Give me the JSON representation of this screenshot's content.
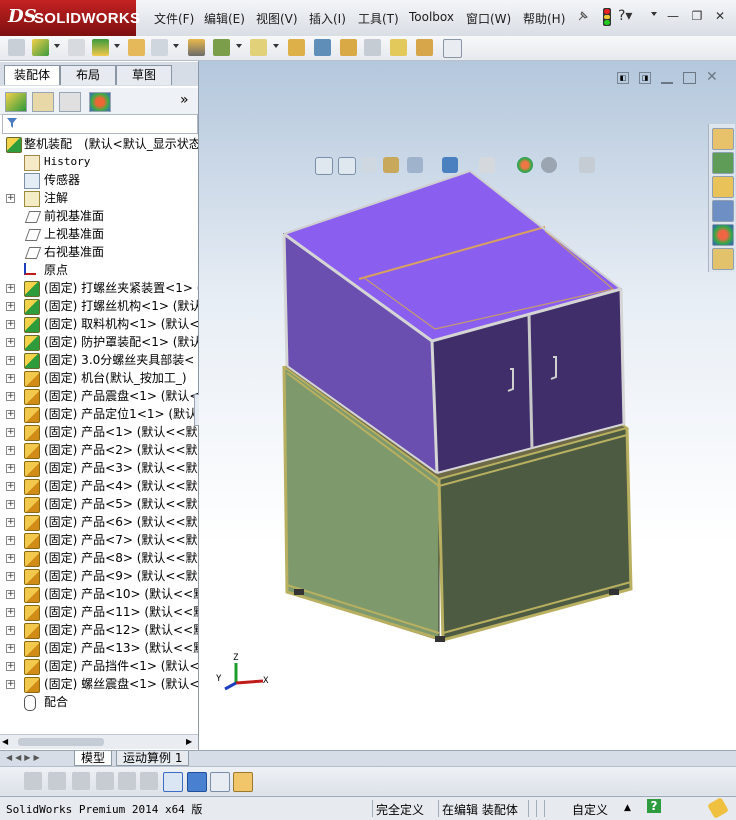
{
  "app": {
    "logo_ds": "DS",
    "logo_text": "SOLIDWORKS",
    "menus": [
      "文件(F)",
      "编辑(E)",
      "视图(V)",
      "插入(I)",
      "工具(T)",
      "Toolbox",
      "窗口(W)",
      "帮助(H)"
    ],
    "window_controls": [
      "—",
      "❐",
      "✕"
    ]
  },
  "manager": {
    "tabs": [
      "装配体",
      "布局",
      "草图"
    ],
    "more": "»",
    "tree": [
      {
        "label": "整机装配　(默认<默认_显示状态",
        "icon": "assembly-icon",
        "expand": "",
        "indent": 0,
        "mono": false
      },
      {
        "label": "History",
        "icon": "history-icon",
        "expand": "",
        "indent": 1,
        "mono": true
      },
      {
        "label": "传感器",
        "icon": "sensor-icon",
        "expand": "",
        "indent": 1,
        "mono": false
      },
      {
        "label": "注解",
        "icon": "annotation-icon",
        "expand": "+",
        "indent": 1,
        "mono": false
      },
      {
        "label": "前视基准面",
        "icon": "plane-icon",
        "expand": "",
        "indent": 1,
        "mono": false
      },
      {
        "label": "上视基准面",
        "icon": "plane-icon",
        "expand": "",
        "indent": 1,
        "mono": false
      },
      {
        "label": "右视基准面",
        "icon": "plane-icon",
        "expand": "",
        "indent": 1,
        "mono": false
      },
      {
        "label": "原点",
        "icon": "origin-icon",
        "expand": "",
        "indent": 1,
        "mono": false
      },
      {
        "label": "(固定) 打螺丝夹紧装置<1> (",
        "icon": "subassembly-icon",
        "expand": "+",
        "indent": 1,
        "mono": false
      },
      {
        "label": "(固定) 打螺丝机构<1> (默认",
        "icon": "subassembly-icon",
        "expand": "+",
        "indent": 1,
        "mono": false
      },
      {
        "label": "(固定) 取料机构<1> (默认<",
        "icon": "subassembly-icon",
        "expand": "+",
        "indent": 1,
        "mono": false
      },
      {
        "label": "(固定) 防护罩装配<1> (默认",
        "icon": "subassembly-icon",
        "expand": "+",
        "indent": 1,
        "mono": false
      },
      {
        "label": "(固定) 3.0分螺丝夹具部装<",
        "icon": "subassembly-icon",
        "expand": "+",
        "indent": 1,
        "mono": false
      },
      {
        "label": "(固定) 机台(默认_按加工_)",
        "icon": "part-icon",
        "expand": "+",
        "indent": 1,
        "mono": false
      },
      {
        "label": "(固定) 产品震盘<1> (默认<",
        "icon": "part-icon",
        "expand": "+",
        "indent": 1,
        "mono": false
      },
      {
        "label": "(固定) 产品定位1<1> (默认",
        "icon": "part-icon",
        "expand": "+",
        "indent": 1,
        "mono": false
      },
      {
        "label": "(固定) 产品<1> (默认<<默认",
        "icon": "part-icon",
        "expand": "+",
        "indent": 1,
        "mono": false
      },
      {
        "label": "(固定) 产品<2> (默认<<默认",
        "icon": "part-icon",
        "expand": "+",
        "indent": 1,
        "mono": false
      },
      {
        "label": "(固定) 产品<3> (默认<<默认",
        "icon": "part-icon",
        "expand": "+",
        "indent": 1,
        "mono": false
      },
      {
        "label": "(固定) 产品<4> (默认<<默认",
        "icon": "part-icon",
        "expand": "+",
        "indent": 1,
        "mono": false
      },
      {
        "label": "(固定) 产品<5> (默认<<默认",
        "icon": "part-icon",
        "expand": "+",
        "indent": 1,
        "mono": false
      },
      {
        "label": "(固定) 产品<6> (默认<<默认",
        "icon": "part-icon",
        "expand": "+",
        "indent": 1,
        "mono": false
      },
      {
        "label": "(固定) 产品<7> (默认<<默认",
        "icon": "part-icon",
        "expand": "+",
        "indent": 1,
        "mono": false
      },
      {
        "label": "(固定) 产品<8> (默认<<默认",
        "icon": "part-icon",
        "expand": "+",
        "indent": 1,
        "mono": false
      },
      {
        "label": "(固定) 产品<9> (默认<<默认",
        "icon": "part-icon",
        "expand": "+",
        "indent": 1,
        "mono": false
      },
      {
        "label": "(固定) 产品<10> (默认<<默",
        "icon": "part-icon",
        "expand": "+",
        "indent": 1,
        "mono": false
      },
      {
        "label": "(固定) 产品<11> (默认<<默",
        "icon": "part-icon",
        "expand": "+",
        "indent": 1,
        "mono": false
      },
      {
        "label": "(固定) 产品<12> (默认<<默",
        "icon": "part-icon",
        "expand": "+",
        "indent": 1,
        "mono": false
      },
      {
        "label": "(固定) 产品<13> (默认<<默",
        "icon": "part-icon",
        "expand": "+",
        "indent": 1,
        "mono": false
      },
      {
        "label": "(固定) 产品挡件<1> (默认<",
        "icon": "part-icon",
        "expand": "+",
        "indent": 1,
        "mono": false
      },
      {
        "label": "(固定) 螺丝震盘<1> (默认<",
        "icon": "part-icon",
        "expand": "+",
        "indent": 1,
        "mono": false
      },
      {
        "label": "配合",
        "icon": "mates-icon",
        "expand": "",
        "indent": 1,
        "mono": false
      }
    ]
  },
  "bottom_tabs": [
    "模型",
    "运动算例 1"
  ],
  "status": {
    "product": "SolidWorks Premium 2014 x64 版",
    "definition": "完全定义",
    "mode": "在编辑 装配体",
    "units": "自定义",
    "units_arrow": "▲",
    "help": "?"
  },
  "triad": {
    "z": "Z",
    "y": "Y",
    "x": "X"
  },
  "colors": {
    "cabinet_top": "#8b5cf6",
    "cabinet_side": "#5b3fa0",
    "base_front": "#4a5a3e",
    "base_side": "#7a9a6a",
    "frame": "#b8b060",
    "accent_red": "#c42222"
  }
}
